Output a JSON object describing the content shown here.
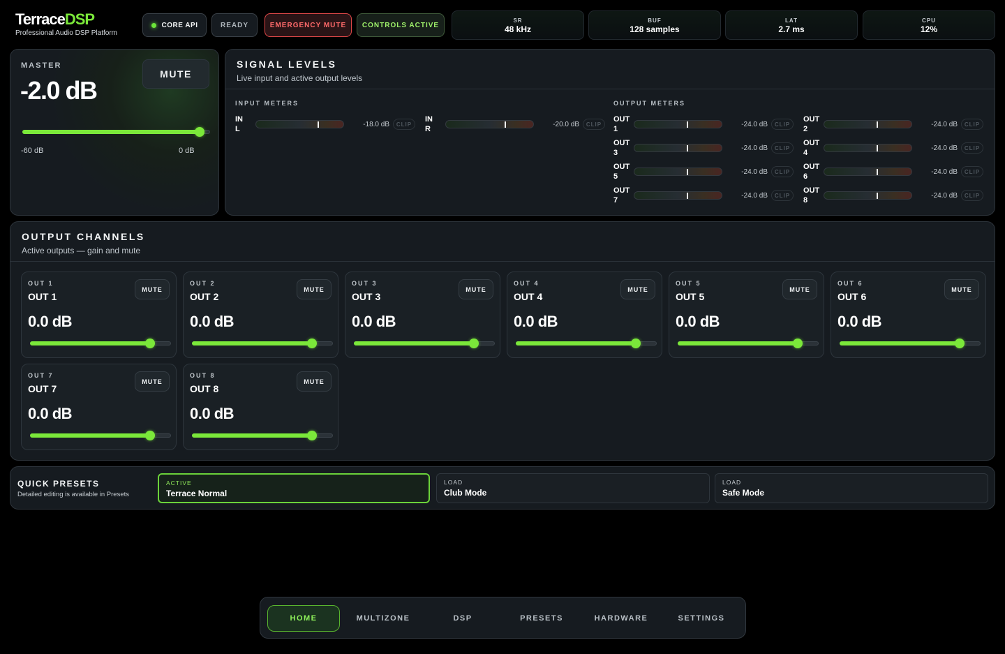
{
  "brand": {
    "title_main": "Terrace",
    "title_accent": "DSP",
    "subtitle": "Professional Audio DSP Platform"
  },
  "status_chips": {
    "core": "CORE API",
    "ready": "READY",
    "emergency": "EMERGENCY MUTE",
    "controls": "CONTROLS ACTIVE"
  },
  "stats": [
    {
      "label": "SR",
      "value": "48 kHz"
    },
    {
      "label": "BUF",
      "value": "128 samples"
    },
    {
      "label": "LAT",
      "value": "2.7 ms"
    },
    {
      "label": "CPU",
      "value": "12%"
    }
  ],
  "master": {
    "label": "MASTER",
    "value": "-2.0 dB",
    "mute_label": "MUTE",
    "min_label": "-60 dB",
    "max_label": "0 dB",
    "fader_fraction": 0.9667
  },
  "signal": {
    "title": "SIGNAL LEVELS",
    "subtitle": "Live input and active output levels",
    "input_label": "INPUT METERS",
    "output_label": "OUTPUT METERS",
    "clip_label": "CLIP",
    "inputs": [
      {
        "name_line1": "IN",
        "name_line2": "L",
        "level": "-18.0 dB",
        "peak_fraction": 0.7
      },
      {
        "name_line1": "IN",
        "name_line2": "R",
        "level": "-20.0 dB",
        "peak_fraction": 0.67
      }
    ],
    "outputs": [
      {
        "name_line1": "OUT",
        "name_line2": "1",
        "level": "-24.0 dB",
        "peak_fraction": 0.6
      },
      {
        "name_line1": "OUT",
        "name_line2": "2",
        "level": "-24.0 dB",
        "peak_fraction": 0.6
      },
      {
        "name_line1": "OUT",
        "name_line2": "3",
        "level": "-24.0 dB",
        "peak_fraction": 0.6
      },
      {
        "name_line1": "OUT",
        "name_line2": "4",
        "level": "-24.0 dB",
        "peak_fraction": 0.6
      },
      {
        "name_line1": "OUT",
        "name_line2": "5",
        "level": "-24.0 dB",
        "peak_fraction": 0.6
      },
      {
        "name_line1": "OUT",
        "name_line2": "6",
        "level": "-24.0 dB",
        "peak_fraction": 0.6
      },
      {
        "name_line1": "OUT",
        "name_line2": "7",
        "level": "-24.0 dB",
        "peak_fraction": 0.6
      },
      {
        "name_line1": "OUT",
        "name_line2": "8",
        "level": "-24.0 dB",
        "peak_fraction": 0.6
      }
    ]
  },
  "outputs": {
    "title": "OUTPUT CHANNELS",
    "subtitle": "Active outputs — gain and mute",
    "mute_label": "MUTE",
    "channels": [
      {
        "id": "OUT 1",
        "name": "OUT 1",
        "gain": "0.0 dB",
        "fader_fraction": 0.88
      },
      {
        "id": "OUT 2",
        "name": "OUT 2",
        "gain": "0.0 dB",
        "fader_fraction": 0.88
      },
      {
        "id": "OUT 3",
        "name": "OUT 3",
        "gain": "0.0 dB",
        "fader_fraction": 0.88
      },
      {
        "id": "OUT 4",
        "name": "OUT 4",
        "gain": "0.0 dB",
        "fader_fraction": 0.88
      },
      {
        "id": "OUT 5",
        "name": "OUT 5",
        "gain": "0.0 dB",
        "fader_fraction": 0.88
      },
      {
        "id": "OUT 6",
        "name": "OUT 6",
        "gain": "0.0 dB",
        "fader_fraction": 0.88
      },
      {
        "id": "OUT 7",
        "name": "OUT 7",
        "gain": "0.0 dB",
        "fader_fraction": 0.88
      },
      {
        "id": "OUT 8",
        "name": "OUT 8",
        "gain": "0.0 dB",
        "fader_fraction": 0.88
      }
    ]
  },
  "presets": {
    "title": "QUICK PRESETS",
    "subtitle": "Detailed editing is available in Presets",
    "items": [
      {
        "state": "ACTIVE",
        "name": "Terrace Normal"
      },
      {
        "state": "LOAD",
        "name": "Club Mode"
      },
      {
        "state": "LOAD",
        "name": "Safe Mode"
      }
    ]
  },
  "nav": {
    "items": [
      "HOME",
      "MULTIZONE",
      "DSP",
      "PRESETS",
      "HARDWARE",
      "SETTINGS"
    ],
    "active": "HOME"
  },
  "colors": {
    "accent": "#7be83a",
    "emergency": "#ff6a6a",
    "background": "#000000",
    "panel": "#161b20"
  }
}
